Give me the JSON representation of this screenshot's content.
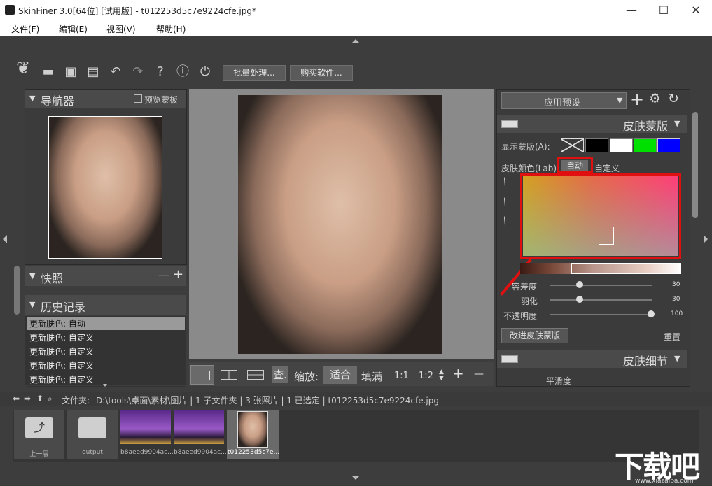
{
  "window": {
    "title": "SkinFiner 3.0[64位] [试用版] - t012253d5c7e9224cfe.jpg*",
    "min": "—",
    "max": "☐",
    "close": "✕"
  },
  "menu": {
    "file": "文件(F)",
    "edit": "编辑(E)",
    "view": "视图(V)",
    "help": "帮助(H)"
  },
  "toolbar": {
    "batch": "批量处理...",
    "buy": "购买软件...",
    "help": "?",
    "info": "ⓘ"
  },
  "navigator": {
    "title": "导航器",
    "preview_mask": "预览蒙板"
  },
  "snapshot": {
    "title": "快照",
    "minus": "—",
    "plus": "+"
  },
  "history": {
    "title": "历史记录",
    "items": [
      "更新肤色: 自动",
      "更新肤色: 自定义",
      "更新肤色: 自定义",
      "更新肤色: 自定义",
      "更新肤色: 自定义"
    ]
  },
  "view_bar": {
    "check": "查.",
    "zoom": "缩放:",
    "fit": "适合",
    "fill": "填满",
    "r11": "1:1",
    "r12": "1:2",
    "plus": "+",
    "minus": "—"
  },
  "right": {
    "preset": "应用预设",
    "skin_mask": "皮肤蒙版",
    "show_mask": "显示蒙版(A):",
    "skin_color": "皮肤颜色(Lab):",
    "auto": "自动",
    "custom": "自定义",
    "tolerance": "容差度",
    "feather": "羽化",
    "opacity": "不透明度",
    "tolerance_val": "30",
    "feather_val": "30",
    "opacity_val": "100",
    "improve": "改进皮肤蒙版",
    "reset": "重置",
    "skin_detail": "皮肤细节",
    "smooth": "平滑度",
    "mask_colors": [
      "#000000",
      "#ffffff",
      "#00e000",
      "#0000ff"
    ]
  },
  "pathbar": {
    "label": "文件夹:",
    "path": "D:\\tools\\桌面\\素材\\图片 | 1 子文件夹 | 3 张照片 | 1 已选定 | t012253d5c7e9224cfe.jpg"
  },
  "filmstrip": {
    "items": [
      "上一层",
      "output",
      "b8aeed9904ac...",
      "b8aeed9904ac...",
      "t012253d5c7e..."
    ]
  },
  "watermark": {
    "text": "下载吧",
    "url": "www.xiazaiba.com"
  }
}
